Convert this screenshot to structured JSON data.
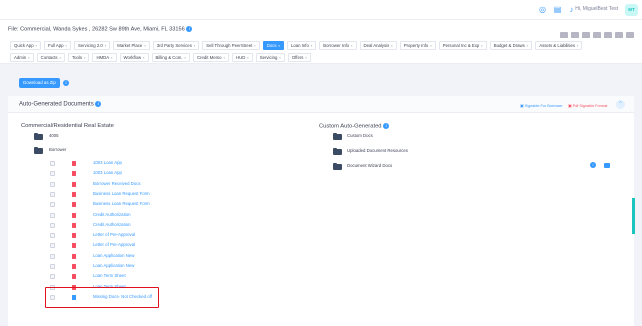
{
  "topbar": {
    "greeting": "Hi, MiguelBest Test",
    "avatar_initials": "MT",
    "icons": [
      "target-icon",
      "notes-icon",
      "bell-icon"
    ]
  },
  "file_title": "File: Commercial, Wanda Sykes , 26282 Sw 89th Ave, Miami, FL 33156",
  "tabs_row1": [
    "Quick App",
    "Full App",
    "Servicing 2.0",
    "Market Place",
    "3rd Party Services",
    "Sell Through PeerStreet",
    "Docs",
    "Loan Info",
    "Borrower Info",
    "Deal Analysis",
    "Property Info",
    "Personal Inc & Exp",
    "Budget & Draws",
    "Assets & Liabilities"
  ],
  "tabs_row2": [
    "Admin",
    "Contacts",
    "Tools",
    "HMDA",
    "Workflow",
    "Billing & Com.",
    "Credit Memo",
    "HUD",
    "Servicing",
    "Offers"
  ],
  "active_tab": "Docs",
  "download_button": "Download as Zip",
  "panel": {
    "title": "Auto-Generated Documents",
    "signable_for_borrower": "Signable For Borrower",
    "pdf_signable_format": "Pdf Signable Format"
  },
  "left_column": {
    "heading": "Commercial/Residential Real Estate",
    "folders": [
      "4005",
      "Borrower"
    ],
    "documents": [
      "1003 Loan App",
      "1003 Loan App",
      "Borrower Received Docs",
      "Business Loan Request Form",
      "Business Loan Request Form",
      "Credit Authorization",
      "Credit Authorization",
      "Letter of Pre-Approval",
      "Letter of Pre-Approval",
      "Loan Application New",
      "Loan Application New",
      "Loan Term Sheet",
      "Loan Term Sheet",
      "Missing Docs- Not Checked off"
    ]
  },
  "right_column": {
    "heading": "Custom Auto-Generated",
    "folders": [
      "Custom Docs",
      "Uploaded Document Resources",
      "Document Wizard Docs"
    ]
  },
  "colors": {
    "accent": "#3699ff",
    "danger": "#f64e60",
    "highlight": "#e0101e"
  }
}
